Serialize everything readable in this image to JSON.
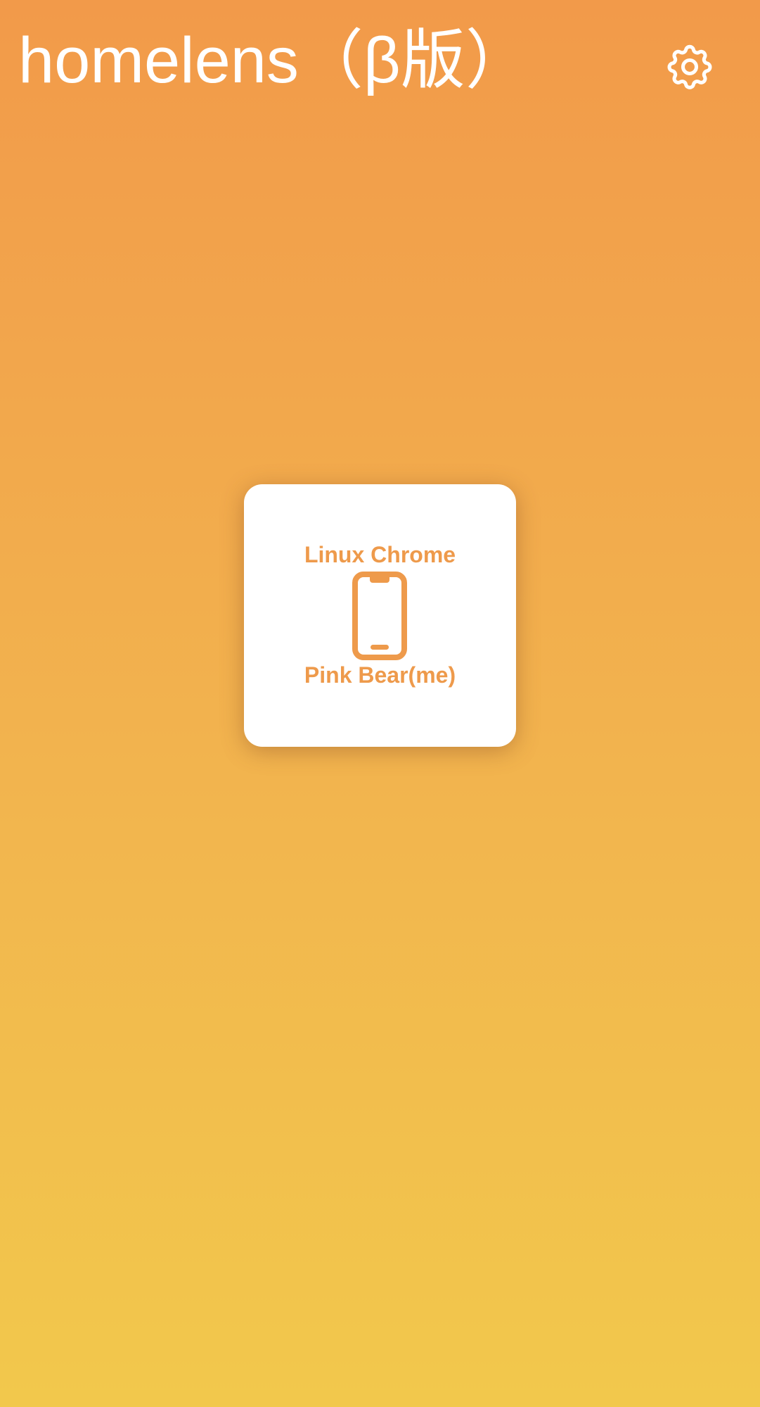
{
  "header": {
    "title": "homelens（β版）",
    "settings_icon": "gear-icon"
  },
  "device_card": {
    "browser_label": "Linux Chrome",
    "device_icon": "smartphone-icon",
    "owner_label": "Pink Bear(me)"
  },
  "colors": {
    "gradient_top": "#f29a4a",
    "gradient_bottom": "#f2c84c",
    "accent": "#ee9a4b",
    "card_background": "#ffffff",
    "title_text": "#ffffff"
  }
}
